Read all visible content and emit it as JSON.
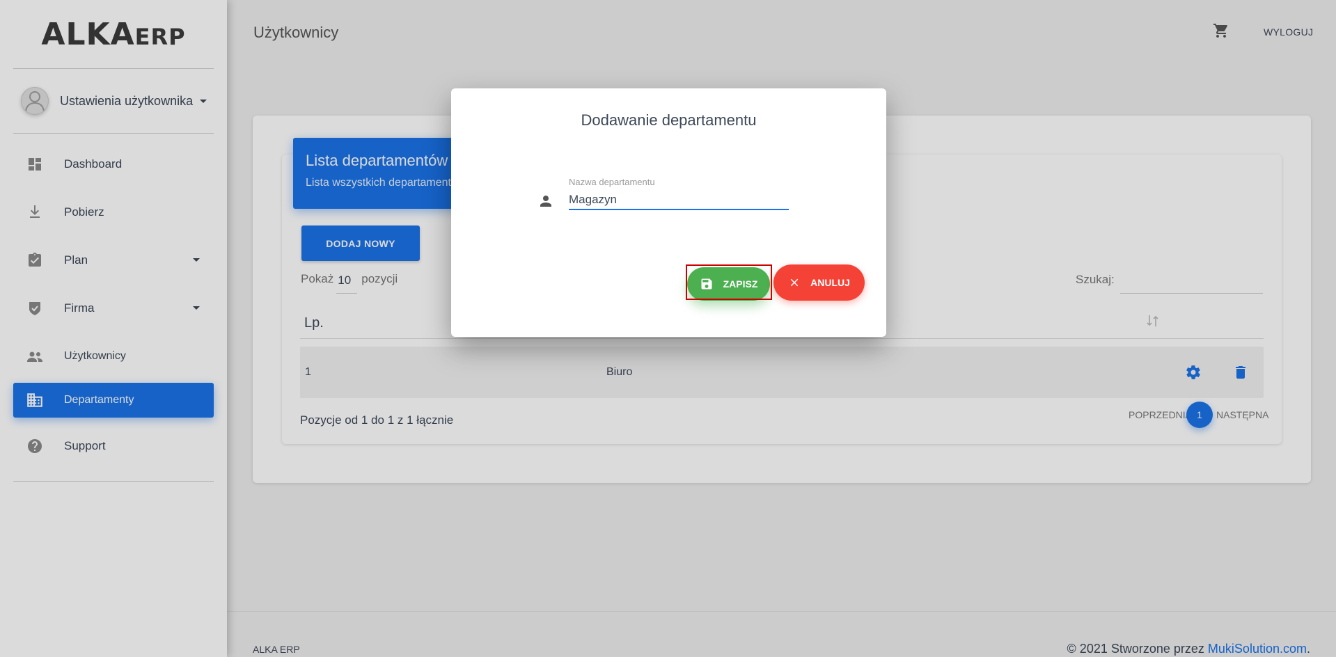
{
  "sidebar": {
    "logo_main": "ALKA",
    "logo_suffix": "ERP",
    "user_label": "Ustawienia użytkownika",
    "items": [
      {
        "label": "Dashboard",
        "icon": "dashboard-icon"
      },
      {
        "label": "Pobierz",
        "icon": "download-icon"
      },
      {
        "label": "Plan",
        "icon": "clipboard-check-icon"
      },
      {
        "label": "Firma",
        "icon": "shield-check-icon"
      },
      {
        "label": "Użytkownicy",
        "icon": "people-icon"
      },
      {
        "label": "Departamenty",
        "icon": "building-icon",
        "active": true
      },
      {
        "label": "Support",
        "icon": "help-icon"
      }
    ]
  },
  "header": {
    "title": "Użytkownicy",
    "logout": "WYLOGUJ"
  },
  "card": {
    "title": "Lista departamentów",
    "subtitle": "Lista wszystkich departamentów",
    "add_button": "DODAJ NOWY",
    "show_prefix": "Pokaż",
    "show_count": "10",
    "show_suffix": "pozycji",
    "search_label": "Szukaj:",
    "columns": [
      "Lp."
    ],
    "rows": [
      {
        "lp": "1",
        "name": "Biuro"
      }
    ],
    "summary": "Pozycje od 1 do 1 z 1 łącznie",
    "pagination": {
      "prev": "POPRZEDNIA",
      "current": "1",
      "next": "NASTĘPNA"
    }
  },
  "footer": {
    "left": "ALKA ERP",
    "right_prefix": "© 2021 Stworzone przez ",
    "right_link": "MukiSolution.com",
    "right_suffix": "."
  },
  "modal": {
    "title": "Dodawanie departamentu",
    "field_label": "Nazwa departamentu",
    "field_value": "Magazyn",
    "save": "ZAPISZ",
    "cancel": "ANULUJ"
  },
  "colors": {
    "primary": "#1a73e8",
    "success": "#4caf50",
    "danger": "#f44336",
    "highlight": "#cc0000"
  }
}
